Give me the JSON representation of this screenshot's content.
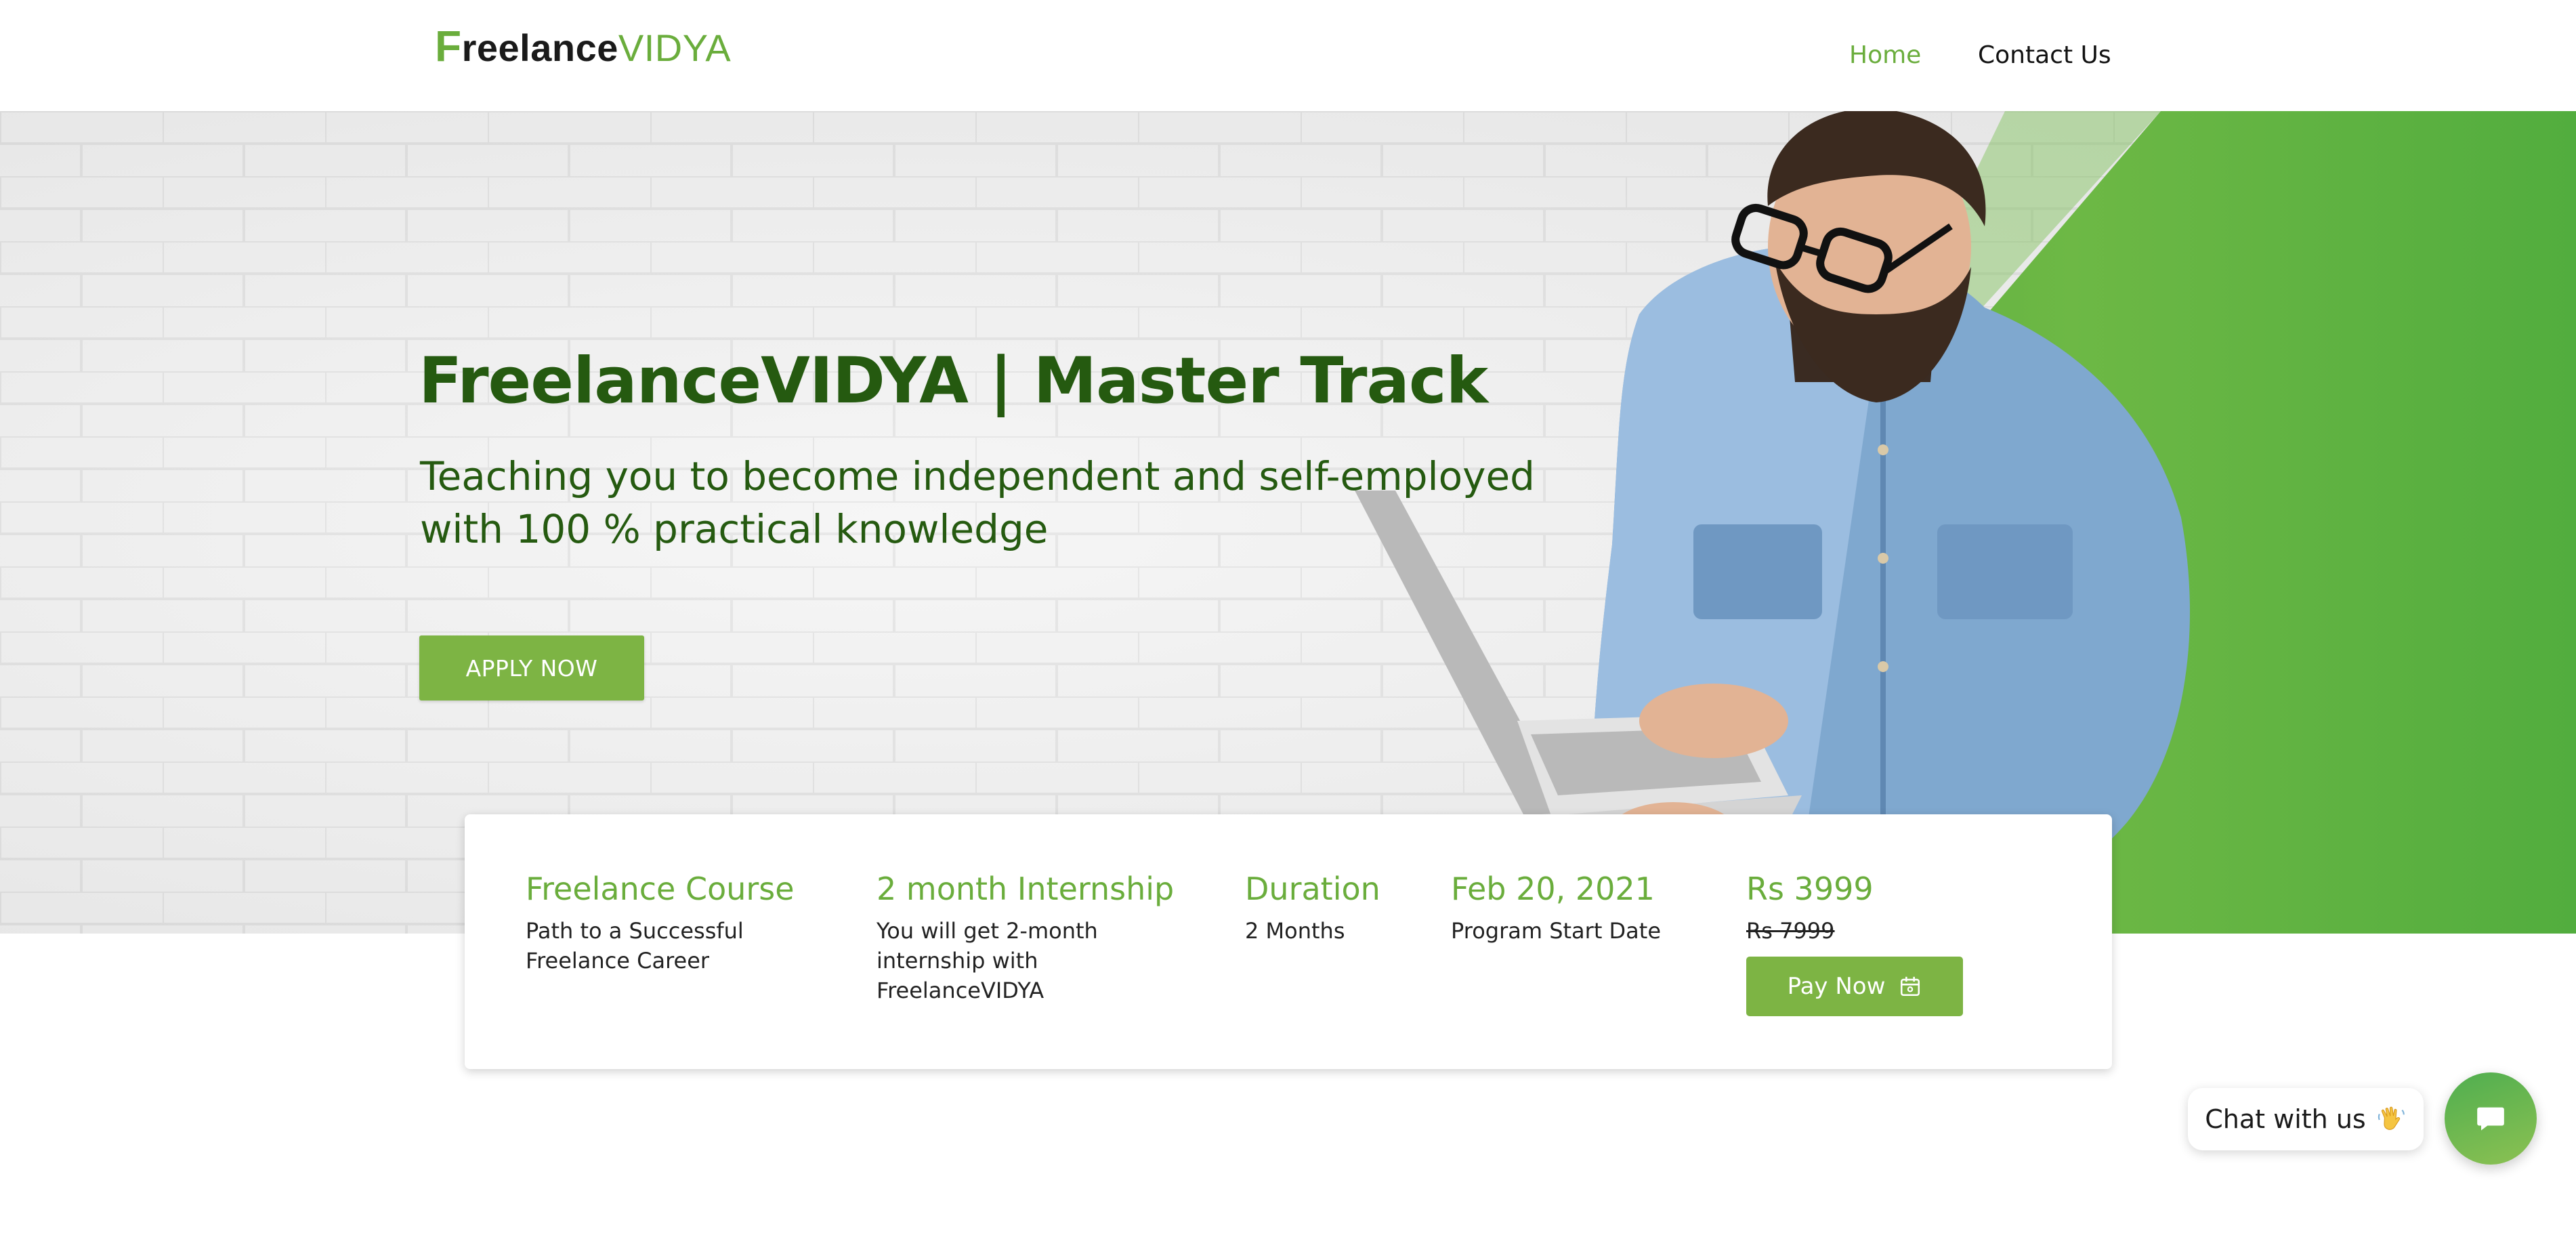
{
  "header": {
    "logo": {
      "first_letter": "F",
      "middle": "reelance",
      "suffix": "VIDYA"
    },
    "nav": [
      {
        "label": "Home",
        "active": true
      },
      {
        "label": "Contact Us",
        "active": false
      }
    ]
  },
  "hero": {
    "title": "FreelanceVIDYA | Master Track",
    "subtitle": "Teaching you to become independent and self-employed with 100 % practical knowledge",
    "apply_label": "APPLY NOW"
  },
  "info_card": {
    "columns": [
      {
        "heading": "Freelance Course",
        "text": "Path to a Successful Freelance Career"
      },
      {
        "heading": "2 month Internship",
        "text": "You will get 2-month internship with FreelanceVIDYA"
      },
      {
        "heading": "Duration",
        "text": "2 Months"
      },
      {
        "heading": "Feb 20, 2021",
        "text": "Program Start Date"
      }
    ],
    "price": {
      "current": "Rs 3999",
      "old": "Rs 7999",
      "pay_label": "Pay Now",
      "pay_icon": "payment-icon"
    }
  },
  "chat": {
    "label": "Chat with us",
    "wave_icon": "waving-hand-icon",
    "button_icon": "chat-icon"
  },
  "colors": {
    "brand_green": "#6aad3c",
    "button_green": "#7db444",
    "title_green": "#255a10",
    "panel_green": "#52ad3e"
  }
}
